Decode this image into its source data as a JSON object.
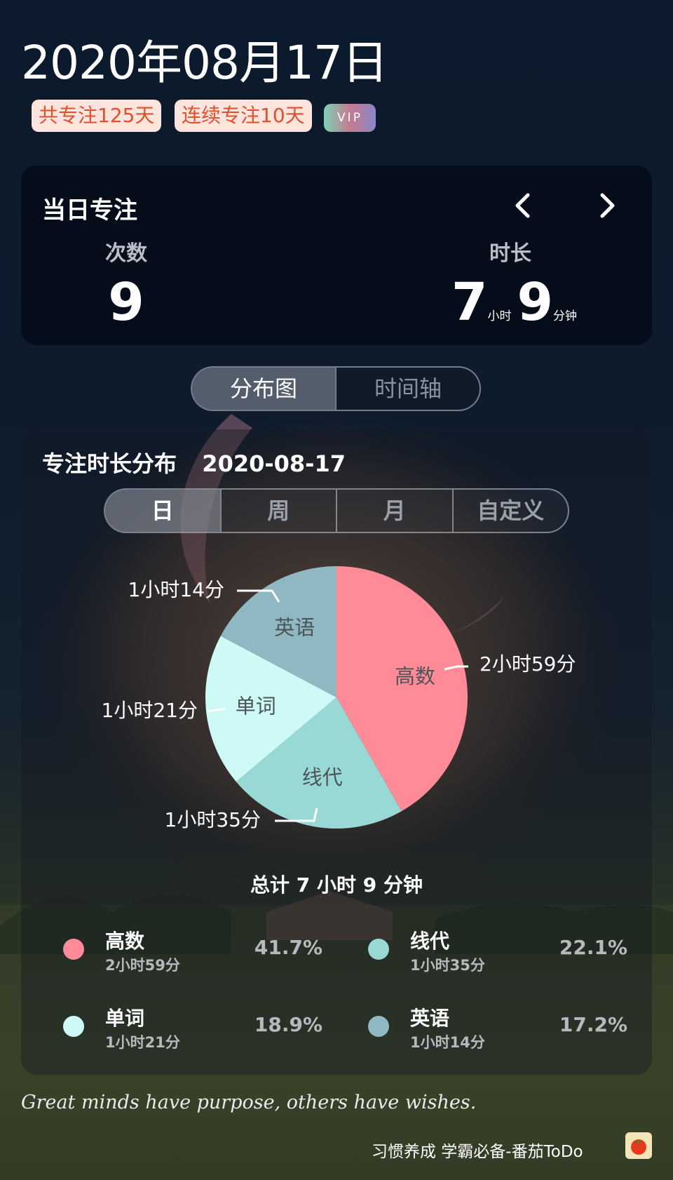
{
  "header": {
    "date": "2020年08月17日",
    "badges": [
      "共专注125天",
      "连续专注10天"
    ],
    "vip": "VIP"
  },
  "daily": {
    "title": "当日专注",
    "count_label": "次数",
    "count_value": "9",
    "duration_label": "时长",
    "hours": "7",
    "hours_unit": "小时",
    "minutes": "9",
    "minutes_unit": "分钟"
  },
  "view_tabs": [
    {
      "label": "分布图",
      "active": true
    },
    {
      "label": "时间轴",
      "active": false
    }
  ],
  "distribution": {
    "title": "专注时长分布",
    "date": "2020-08-17",
    "range_tabs": [
      {
        "label": "日",
        "active": true
      },
      {
        "label": "周",
        "active": false
      },
      {
        "label": "月",
        "active": false
      },
      {
        "label": "自定义",
        "active": false
      }
    ],
    "total": "总计 7 小时 9 分钟"
  },
  "chart_data": {
    "type": "pie",
    "unit": "minutes",
    "slices": [
      {
        "label": "高数",
        "value": 179,
        "display": "2小时59分",
        "percent": "41.7%",
        "color": "#ff8a98"
      },
      {
        "label": "线代",
        "value": 95,
        "display": "1小时35分",
        "percent": "22.1%",
        "color": "#98d9d6"
      },
      {
        "label": "单词",
        "value": 81,
        "display": "1小时21分",
        "percent": "18.9%",
        "color": "#cdfaf7"
      },
      {
        "label": "英语",
        "value": 74,
        "display": "1小时14分",
        "percent": "17.2%",
        "color": "#8fb8c3"
      }
    ]
  },
  "quote": "Great minds have purpose, others have wishes.",
  "footer": {
    "slogan": "习惯养成 学霸必备-番茄ToDo",
    "app_icon": "tomato-icon"
  }
}
